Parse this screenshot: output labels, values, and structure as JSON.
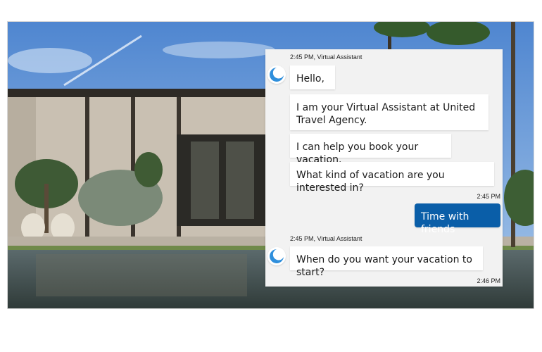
{
  "chat": {
    "assistant_name": "Virtual Assistant",
    "group1_meta": "2:45 PM, Virtual Assistant",
    "messages_group1": [
      "Hello,",
      "I am your Virtual Assistant at United Travel Agency.",
      "I can help you book your vacation.",
      "What kind of vacation are you interested in?"
    ],
    "user_meta": "2:45 PM",
    "user_message": "Time with friends",
    "group2_meta": "2:45 PM, Virtual Assistant",
    "messages_group2": [
      "When do you want your vacation to start?"
    ],
    "footer_meta": "2:46 PM"
  },
  "colors": {
    "panel_bg": "#f2f2f2",
    "user_bubble": "#0a5ea8",
    "avatar_accent": "#2f8fdc"
  },
  "icons": {
    "avatar": "crescent-moon-avatar-icon"
  }
}
